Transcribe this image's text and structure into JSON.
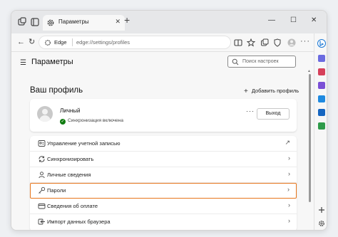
{
  "tab": {
    "title": "Параметры",
    "close": "✕"
  },
  "newtab": "+",
  "window_controls": {
    "minimize": "—",
    "maximize": "☐",
    "close": "✕"
  },
  "nav": {
    "back": "←",
    "reload": "↻"
  },
  "address": {
    "brand": "Edge",
    "url": "edge://settings/profiles"
  },
  "page": {
    "menu": "☰",
    "title": "Параметры",
    "search_placeholder": "Поиск настроек",
    "section_title": "Ваш профиль",
    "add_profile": "Добавить профиль",
    "add_icon": "+"
  },
  "profile": {
    "name": "Личный",
    "sync_status": "Синхронизация включена",
    "sync_icon": "✓",
    "more": "···",
    "logout": "Выход"
  },
  "menu_items": [
    {
      "label": "Управление учетной записью",
      "icon": "account-icon",
      "action": "↗"
    },
    {
      "label": "Синхронизировать",
      "icon": "sync-icon",
      "action": "›"
    },
    {
      "label": "Личные сведения",
      "icon": "person-icon",
      "action": "›"
    },
    {
      "label": "Пароли",
      "icon": "key-icon",
      "action": "›",
      "highlighted": true
    },
    {
      "label": "Сведения об оплате",
      "icon": "card-icon",
      "action": "›"
    },
    {
      "label": "Импорт данных браузера",
      "icon": "import-icon",
      "action": "›"
    }
  ],
  "colors": {
    "highlight": "#e7761c",
    "sync_ok": "#107c10",
    "bing": "#1b78d4"
  }
}
